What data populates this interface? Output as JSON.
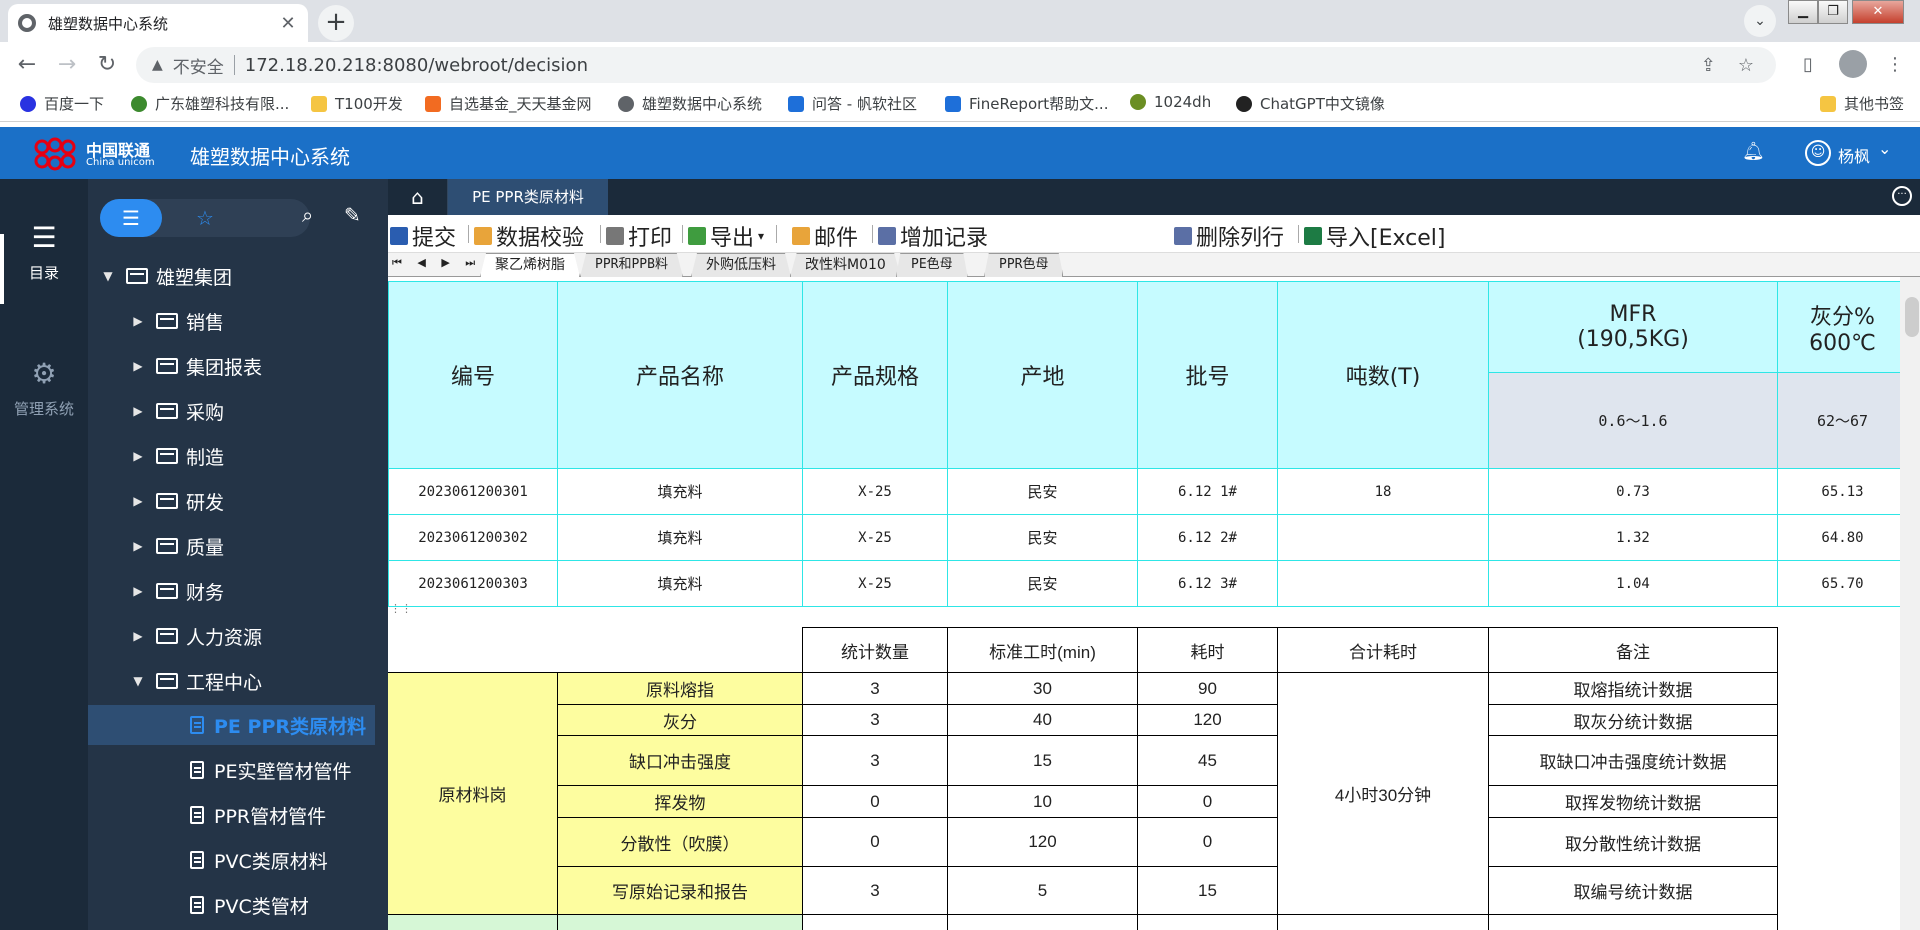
{
  "browser": {
    "tab_title": "雄塑数据中心系统",
    "tab_close": "✕",
    "new_tab": "+",
    "address_warning": "不安全",
    "url": "172.18.20.218:8080/webroot/decision",
    "bookmarks": [
      {
        "label": "百度一下",
        "color": "#2932e1"
      },
      {
        "label": "广东雄塑科技有限...",
        "color": "#3c8a2e"
      },
      {
        "label": "T100开发",
        "color": "#f5c542"
      },
      {
        "label": "自选基金_天天基金网",
        "color": "#f26b21"
      },
      {
        "label": "雄塑数据中心系统",
        "color": "#5f6368"
      },
      {
        "label": "问答 - 帆软社区",
        "color": "#1e6fd9"
      },
      {
        "label": "FineReport帮助文...",
        "color": "#1e6fd9"
      },
      {
        "label": "1024dh",
        "color": "#6b8e23"
      },
      {
        "label": "ChatGPT中文镜像",
        "color": "#222222"
      }
    ],
    "other_bookmarks": "其他书签"
  },
  "app": {
    "logo_cn": "中国联通",
    "logo_en": "China unicom",
    "title": "雄塑数据中心系统",
    "user": "杨枫"
  },
  "rail": [
    {
      "label": "目录",
      "icon": "list-icon"
    },
    {
      "label": "管理系统",
      "icon": "gear-icon"
    }
  ],
  "tree": {
    "root": "雄塑集团",
    "folders": [
      "销售",
      "集团报表",
      "采购",
      "制造",
      "研发",
      "质量",
      "财务",
      "人力资源",
      "工程中心"
    ],
    "reports": [
      "PE PPR类原材料",
      "PE实壁管材管件",
      "PPR管材管件",
      "PVC类原材料",
      "PVC类管材"
    ]
  },
  "content_tab": "PE PPR类原材料",
  "toolbar": {
    "submit": "提交",
    "validate": "数据校验",
    "print": "打印",
    "export": "导出",
    "export_arrow": "▾",
    "mail": "邮件",
    "add_record": "增加记录",
    "delete_row": "删除列行",
    "import_excel": "导入[Excel]"
  },
  "sheet_tabs": [
    "聚乙烯树脂",
    "PPR和PPB料",
    "外购低压料",
    "改性料M010",
    "PE色母",
    "PPR色母"
  ],
  "sheet_nav": "⏮ ◀ ▶ ⏭",
  "grid": {
    "headers": [
      "编号",
      "产品名称",
      "产品规格",
      "产地",
      "批号",
      "吨数(T)",
      "MFR\n(190,5KG)",
      "灰分%\n600℃"
    ],
    "spec_mfr": "0.6～1.6",
    "spec_ash": "62～67",
    "rows": [
      [
        "2023061200301",
        "填充料",
        "X-25",
        "民安",
        "6.12 1#",
        "18",
        "0.73",
        "65.13"
      ],
      [
        "2023061200302",
        "填充料",
        "X-25",
        "民安",
        "6.12 2#",
        "",
        "1.32",
        "64.80"
      ],
      [
        "2023061200303",
        "填充料",
        "X-25",
        "民安",
        "6.12 3#",
        "",
        "1.04",
        "65.70"
      ]
    ]
  },
  "stats": {
    "headers": [
      "统计数量",
      "标准工时(min)",
      "耗时",
      "合计耗时",
      "备注"
    ],
    "post": "原材料岗",
    "total": "4小时30分钟",
    "items": [
      {
        "name": "原料熔指",
        "qty": "3",
        "std": "30",
        "cost": "90",
        "note": "取熔指统计数据"
      },
      {
        "name": "灰分",
        "qty": "3",
        "std": "40",
        "cost": "120",
        "note": "取灰分统计数据"
      },
      {
        "name": "缺口冲击强度",
        "qty": "3",
        "std": "15",
        "cost": "45",
        "note": "取缺口冲击强度统计数据"
      },
      {
        "name": "挥发物",
        "qty": "0",
        "std": "10",
        "cost": "0",
        "note": "取挥发物统计数据"
      },
      {
        "name": "分散性（吹膜）",
        "qty": "0",
        "std": "120",
        "cost": "0",
        "note": "取分散性统计数据"
      },
      {
        "name": "写原始记录和报告",
        "qty": "3",
        "std": "5",
        "cost": "15",
        "note": "取编号统计数据"
      }
    ]
  }
}
